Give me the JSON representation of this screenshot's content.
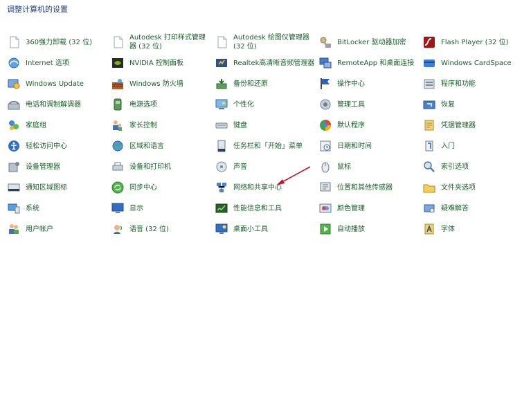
{
  "header": {
    "title": "调整计算机的设置"
  },
  "items": [
    {
      "label": "360强力卸载 (32 位)",
      "icon": "document-icon"
    },
    {
      "label": "Autodesk 打印样式管理\n器 (32 位)",
      "icon": "document-icon"
    },
    {
      "label": "Autodesk 绘图仪管理器\n(32 位)",
      "icon": "document-icon"
    },
    {
      "label": "BitLocker 驱动器加密",
      "icon": "bitlocker-key-icon"
    },
    {
      "label": "Flash Player (32 位)",
      "icon": "flash-player-icon"
    },
    {
      "label": "Internet 选项",
      "icon": "internet-options-icon"
    },
    {
      "label": "NVIDIA 控制面板",
      "icon": "nvidia-icon"
    },
    {
      "label": "Realtek高清晰音频管理器",
      "icon": "realtek-audio-icon"
    },
    {
      "label": "RemoteApp 和桌面连接",
      "icon": "remoteapp-icon"
    },
    {
      "label": "Windows CardSpace",
      "icon": "cardspace-icon"
    },
    {
      "label": "Windows Update",
      "icon": "windows-update-icon"
    },
    {
      "label": "Windows 防火墙",
      "icon": "firewall-icon"
    },
    {
      "label": "备份和还原",
      "icon": "backup-restore-icon"
    },
    {
      "label": "操作中心",
      "icon": "action-center-flag-icon"
    },
    {
      "label": "程序和功能",
      "icon": "programs-features-icon"
    },
    {
      "label": "电话和调制解调器",
      "icon": "phone-modem-icon"
    },
    {
      "label": "电源选项",
      "icon": "power-options-icon"
    },
    {
      "label": "个性化",
      "icon": "personalization-icon"
    },
    {
      "label": "管理工具",
      "icon": "admin-tools-icon"
    },
    {
      "label": "恢复",
      "icon": "recovery-icon"
    },
    {
      "label": "家庭组",
      "icon": "homegroup-icon"
    },
    {
      "label": "家长控制",
      "icon": "parental-controls-icon"
    },
    {
      "label": "键盘",
      "icon": "keyboard-icon"
    },
    {
      "label": "默认程序",
      "icon": "default-programs-icon"
    },
    {
      "label": "凭据管理器",
      "icon": "credential-manager-icon"
    },
    {
      "label": "轻松访问中心",
      "icon": "ease-of-access-icon"
    },
    {
      "label": "区域和语言",
      "icon": "region-language-icon"
    },
    {
      "label": "任务栏和「开始」菜单",
      "icon": "taskbar-start-icon"
    },
    {
      "label": "日期和时间",
      "icon": "date-time-icon"
    },
    {
      "label": "入门",
      "icon": "getting-started-icon"
    },
    {
      "label": "设备管理器",
      "icon": "device-manager-icon"
    },
    {
      "label": "设备和打印机",
      "icon": "devices-printers-icon"
    },
    {
      "label": "声音",
      "icon": "sound-icon"
    },
    {
      "label": "鼠标",
      "icon": "mouse-icon"
    },
    {
      "label": "索引选项",
      "icon": "indexing-options-icon"
    },
    {
      "label": "通知区域图标",
      "icon": "notification-area-icon"
    },
    {
      "label": "同步中心",
      "icon": "sync-center-icon"
    },
    {
      "label": "网络和共享中心",
      "icon": "network-sharing-icon"
    },
    {
      "label": "位置和其他传感器",
      "icon": "location-sensors-icon"
    },
    {
      "label": "文件夹选项",
      "icon": "folder-options-icon"
    },
    {
      "label": "系统",
      "icon": "system-icon"
    },
    {
      "label": "显示",
      "icon": "display-icon"
    },
    {
      "label": "性能信息和工具",
      "icon": "performance-icon"
    },
    {
      "label": "颜色管理",
      "icon": "color-management-icon"
    },
    {
      "label": "疑难解答",
      "icon": "troubleshooting-icon"
    },
    {
      "label": "用户帐户",
      "icon": "user-accounts-icon"
    },
    {
      "label": "语音 (32 位)",
      "icon": "speech-icon"
    },
    {
      "label": "桌面小工具",
      "icon": "desktop-gadgets-icon"
    },
    {
      "label": "自动播放",
      "icon": "autoplay-icon"
    },
    {
      "label": "字体",
      "icon": "fonts-icon"
    }
  ],
  "colors": {
    "link": "#1a5f2a",
    "header": "#1e3d7a",
    "annotation_arrow": "#c0182a"
  }
}
